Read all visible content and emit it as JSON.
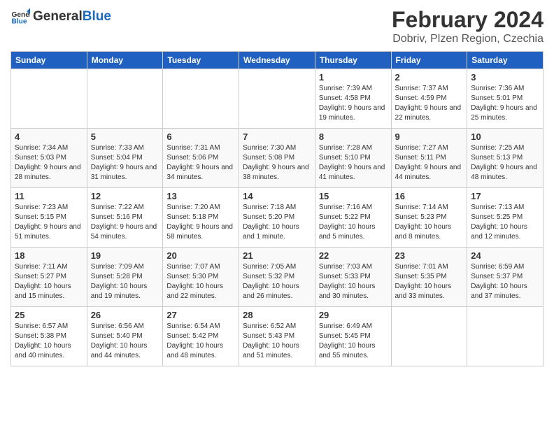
{
  "header": {
    "logo_general": "General",
    "logo_blue": "Blue",
    "month_title": "February 2024",
    "location": "Dobriv, Plzen Region, Czechia"
  },
  "calendar": {
    "days_of_week": [
      "Sunday",
      "Monday",
      "Tuesday",
      "Wednesday",
      "Thursday",
      "Friday",
      "Saturday"
    ],
    "weeks": [
      [
        {
          "day": "",
          "content": ""
        },
        {
          "day": "",
          "content": ""
        },
        {
          "day": "",
          "content": ""
        },
        {
          "day": "",
          "content": ""
        },
        {
          "day": "1",
          "content": "Sunrise: 7:39 AM\nSunset: 4:58 PM\nDaylight: 9 hours\nand 19 minutes."
        },
        {
          "day": "2",
          "content": "Sunrise: 7:37 AM\nSunset: 4:59 PM\nDaylight: 9 hours\nand 22 minutes."
        },
        {
          "day": "3",
          "content": "Sunrise: 7:36 AM\nSunset: 5:01 PM\nDaylight: 9 hours\nand 25 minutes."
        }
      ],
      [
        {
          "day": "4",
          "content": "Sunrise: 7:34 AM\nSunset: 5:03 PM\nDaylight: 9 hours\nand 28 minutes."
        },
        {
          "day": "5",
          "content": "Sunrise: 7:33 AM\nSunset: 5:04 PM\nDaylight: 9 hours\nand 31 minutes."
        },
        {
          "day": "6",
          "content": "Sunrise: 7:31 AM\nSunset: 5:06 PM\nDaylight: 9 hours\nand 34 minutes."
        },
        {
          "day": "7",
          "content": "Sunrise: 7:30 AM\nSunset: 5:08 PM\nDaylight: 9 hours\nand 38 minutes."
        },
        {
          "day": "8",
          "content": "Sunrise: 7:28 AM\nSunset: 5:10 PM\nDaylight: 9 hours\nand 41 minutes."
        },
        {
          "day": "9",
          "content": "Sunrise: 7:27 AM\nSunset: 5:11 PM\nDaylight: 9 hours\nand 44 minutes."
        },
        {
          "day": "10",
          "content": "Sunrise: 7:25 AM\nSunset: 5:13 PM\nDaylight: 9 hours\nand 48 minutes."
        }
      ],
      [
        {
          "day": "11",
          "content": "Sunrise: 7:23 AM\nSunset: 5:15 PM\nDaylight: 9 hours\nand 51 minutes."
        },
        {
          "day": "12",
          "content": "Sunrise: 7:22 AM\nSunset: 5:16 PM\nDaylight: 9 hours\nand 54 minutes."
        },
        {
          "day": "13",
          "content": "Sunrise: 7:20 AM\nSunset: 5:18 PM\nDaylight: 9 hours\nand 58 minutes."
        },
        {
          "day": "14",
          "content": "Sunrise: 7:18 AM\nSunset: 5:20 PM\nDaylight: 10 hours\nand 1 minute."
        },
        {
          "day": "15",
          "content": "Sunrise: 7:16 AM\nSunset: 5:22 PM\nDaylight: 10 hours\nand 5 minutes."
        },
        {
          "day": "16",
          "content": "Sunrise: 7:14 AM\nSunset: 5:23 PM\nDaylight: 10 hours\nand 8 minutes."
        },
        {
          "day": "17",
          "content": "Sunrise: 7:13 AM\nSunset: 5:25 PM\nDaylight: 10 hours\nand 12 minutes."
        }
      ],
      [
        {
          "day": "18",
          "content": "Sunrise: 7:11 AM\nSunset: 5:27 PM\nDaylight: 10 hours\nand 15 minutes."
        },
        {
          "day": "19",
          "content": "Sunrise: 7:09 AM\nSunset: 5:28 PM\nDaylight: 10 hours\nand 19 minutes."
        },
        {
          "day": "20",
          "content": "Sunrise: 7:07 AM\nSunset: 5:30 PM\nDaylight: 10 hours\nand 22 minutes."
        },
        {
          "day": "21",
          "content": "Sunrise: 7:05 AM\nSunset: 5:32 PM\nDaylight: 10 hours\nand 26 minutes."
        },
        {
          "day": "22",
          "content": "Sunrise: 7:03 AM\nSunset: 5:33 PM\nDaylight: 10 hours\nand 30 minutes."
        },
        {
          "day": "23",
          "content": "Sunrise: 7:01 AM\nSunset: 5:35 PM\nDaylight: 10 hours\nand 33 minutes."
        },
        {
          "day": "24",
          "content": "Sunrise: 6:59 AM\nSunset: 5:37 PM\nDaylight: 10 hours\nand 37 minutes."
        }
      ],
      [
        {
          "day": "25",
          "content": "Sunrise: 6:57 AM\nSunset: 5:38 PM\nDaylight: 10 hours\nand 40 minutes."
        },
        {
          "day": "26",
          "content": "Sunrise: 6:56 AM\nSunset: 5:40 PM\nDaylight: 10 hours\nand 44 minutes."
        },
        {
          "day": "27",
          "content": "Sunrise: 6:54 AM\nSunset: 5:42 PM\nDaylight: 10 hours\nand 48 minutes."
        },
        {
          "day": "28",
          "content": "Sunrise: 6:52 AM\nSunset: 5:43 PM\nDaylight: 10 hours\nand 51 minutes."
        },
        {
          "day": "29",
          "content": "Sunrise: 6:49 AM\nSunset: 5:45 PM\nDaylight: 10 hours\nand 55 minutes."
        },
        {
          "day": "",
          "content": ""
        },
        {
          "day": "",
          "content": ""
        }
      ]
    ]
  }
}
